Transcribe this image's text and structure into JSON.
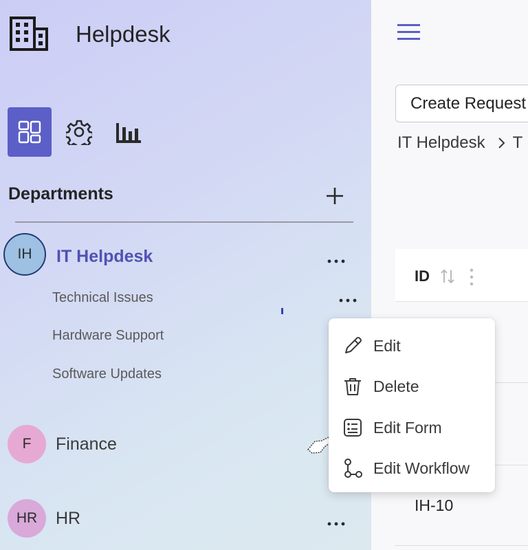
{
  "app": {
    "title": "Helpdesk",
    "logo_icon": "building-icon"
  },
  "nav": {
    "items": [
      {
        "name": "dashboard-icon",
        "active": true
      },
      {
        "name": "gear-icon",
        "active": false
      },
      {
        "name": "bar-chart-icon",
        "active": false
      }
    ],
    "active_color": "#5b5fc7"
  },
  "departments": {
    "title": "Departments",
    "items": [
      {
        "initials": "IH",
        "label": "IT Helpdesk",
        "active": true,
        "avatar_color": "#9ec0e2",
        "subitems": [
          "Technical Issues",
          "Hardware Support",
          "Software Updates"
        ]
      },
      {
        "initials": "F",
        "label": "Finance",
        "active": false,
        "avatar_color": "#e6a9d3",
        "subitems": []
      },
      {
        "initials": "HR",
        "label": "HR",
        "active": false,
        "avatar_color": "#d9a9d9",
        "subitems": []
      }
    ]
  },
  "context_menu": {
    "items": [
      {
        "label": "Edit",
        "icon": "pencil-icon"
      },
      {
        "label": "Delete",
        "icon": "trash-icon"
      },
      {
        "label": "Edit Form",
        "icon": "form-icon"
      },
      {
        "label": "Edit Workflow",
        "icon": "workflow-icon"
      }
    ]
  },
  "main": {
    "create_button": "Create Request",
    "breadcrumb": {
      "root": "IT Helpdesk",
      "next": "T"
    },
    "table": {
      "columns": [
        "ID"
      ],
      "rows": [
        "IH-10"
      ]
    }
  },
  "colors": {
    "accent": "#5b5fc7",
    "active_text": "#4f52b2"
  }
}
